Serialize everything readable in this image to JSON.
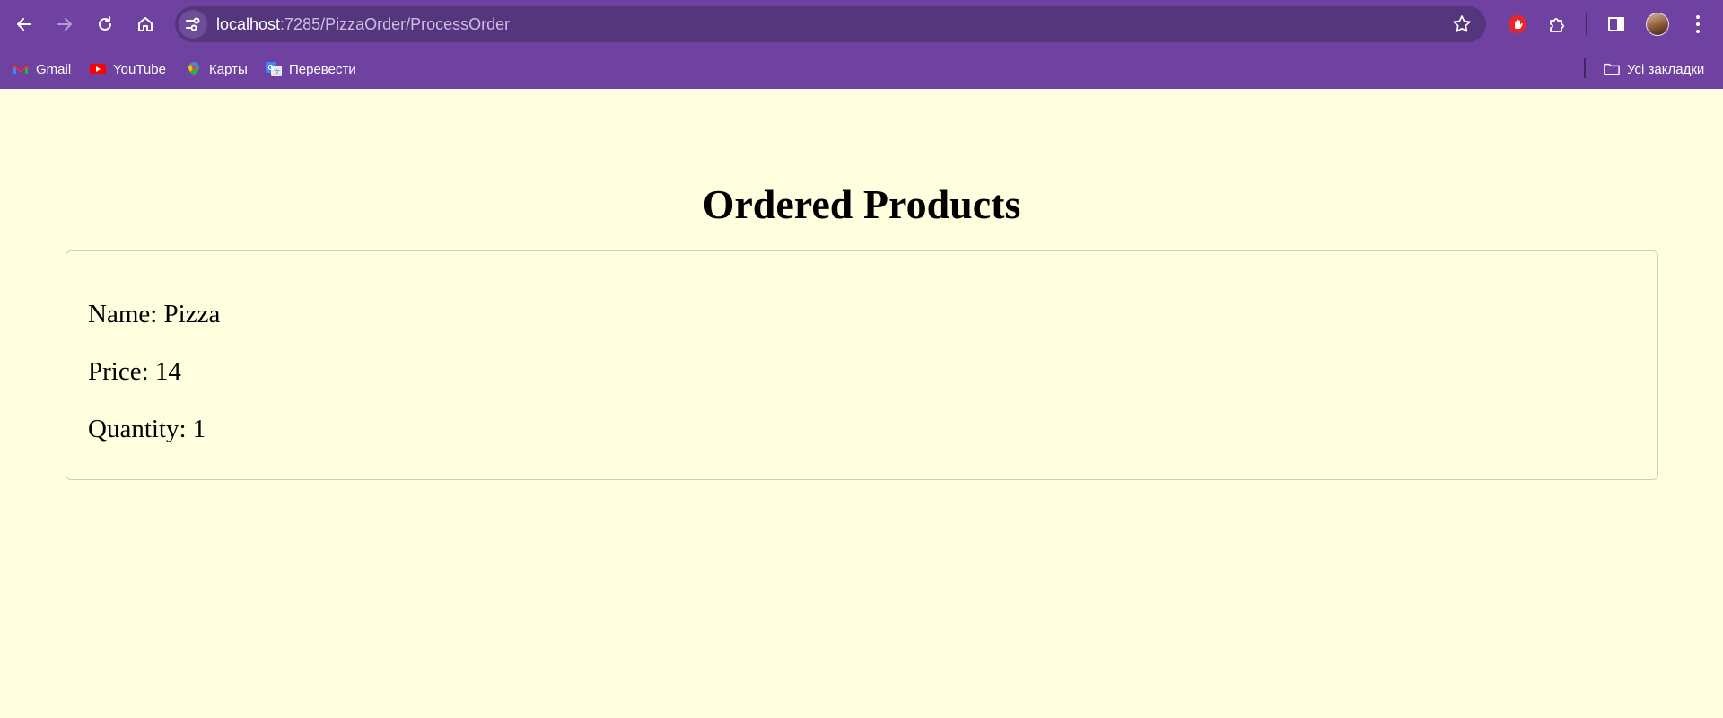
{
  "browser": {
    "url_host": "localhost",
    "url_path": ":7285/PizzaOrder/ProcessOrder",
    "colors": {
      "chrome": "#6f42a1",
      "omnibox": "#55367d"
    },
    "icons": [
      "back-icon",
      "forward-icon",
      "reload-icon",
      "home-icon",
      "site-info-icon",
      "star-icon",
      "adblock-extension-icon",
      "extensions-icon",
      "side-panel-icon",
      "profile-avatar",
      "menu-icon"
    ]
  },
  "bookmarks": {
    "items": [
      {
        "label": "Gmail",
        "icon": "gmail-icon"
      },
      {
        "label": "YouTube",
        "icon": "youtube-icon"
      },
      {
        "label": "Карты",
        "icon": "maps-icon"
      },
      {
        "label": "Перевести",
        "icon": "translate-icon"
      }
    ],
    "all_bookmarks_label": "Усі закладки"
  },
  "page": {
    "background": "#ffffe0",
    "title": "Ordered Products",
    "products": [
      {
        "name_line": "Name: Pizza",
        "price_line": "Price: 14",
        "quantity_line": "Quantity: 1"
      }
    ]
  }
}
